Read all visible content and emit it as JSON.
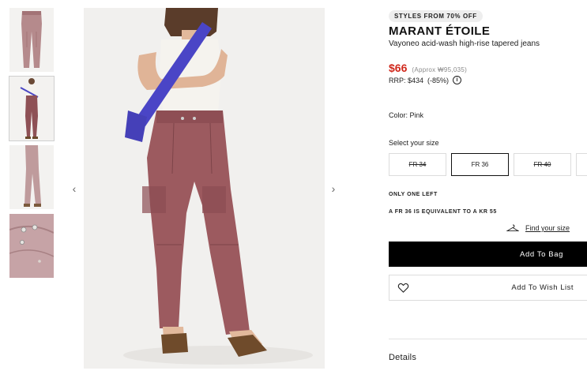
{
  "gallery": {
    "prev_icon": "chevron-left-icon",
    "next_icon": "chevron-right-icon",
    "thumbnails": [
      {
        "name": "front-view"
      },
      {
        "name": "model-view"
      },
      {
        "name": "side-view"
      },
      {
        "name": "detail-view"
      }
    ]
  },
  "product": {
    "promo_badge": "STYLES FROM 70% OFF",
    "brand": "MARANT ÉTOILE",
    "name": "Vayoneo acid-wash high-rise tapered jeans",
    "price": "$66",
    "approx_price": "(Approx ₩95,035)",
    "rrp": "RRP: $434  (-85%)",
    "info_icon_glyph": "i",
    "color_label": "Color: Pink",
    "size_label": "Select your size",
    "sizes": [
      {
        "label": "FR 34",
        "available": false
      },
      {
        "label": "FR 36",
        "available": true,
        "selected": true
      },
      {
        "label": "FR 40",
        "available": false
      }
    ],
    "stock_note": "ONLY ONE LEFT",
    "equivalent_note": "A FR 36 IS EQUIVALENT TO A KR 55",
    "find_size": "Find your size",
    "add_to_bag": "Add To Bag",
    "add_to_wishlist": "Add To Wish List",
    "details": "Details"
  },
  "colors": {
    "price_red": "#d0281c",
    "bag_button_bg": "#000000",
    "jeans_pink": "#9c5a5f"
  }
}
